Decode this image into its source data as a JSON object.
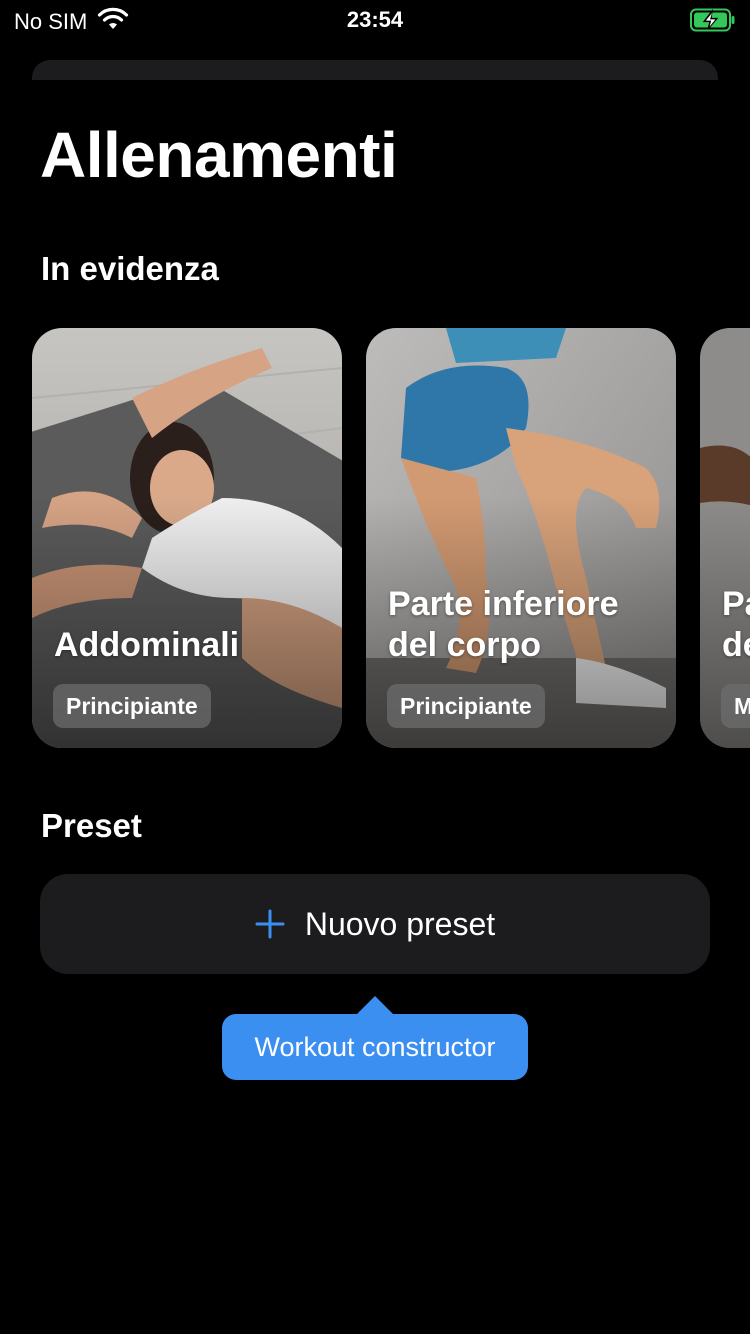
{
  "status_bar": {
    "carrier": "No SIM",
    "time": "23:54",
    "battery_color": "#34c759"
  },
  "page": {
    "title": "Allenamenti"
  },
  "featured": {
    "title": "In evidenza",
    "cards": [
      {
        "title": "Addominali",
        "level": "Principiante"
      },
      {
        "title": "Parte inferiore\ndel corpo",
        "level": "Principiante"
      },
      {
        "title": "Pa\nde",
        "level": "M"
      }
    ]
  },
  "preset": {
    "title": "Preset",
    "new_button_label": "Nuovo preset",
    "accent_color": "#3a8ff0"
  },
  "tooltip": {
    "text": "Workout constructor"
  },
  "icons": {
    "wifi": "wifi-icon",
    "battery": "battery-charging-icon",
    "plus": "plus-icon"
  }
}
